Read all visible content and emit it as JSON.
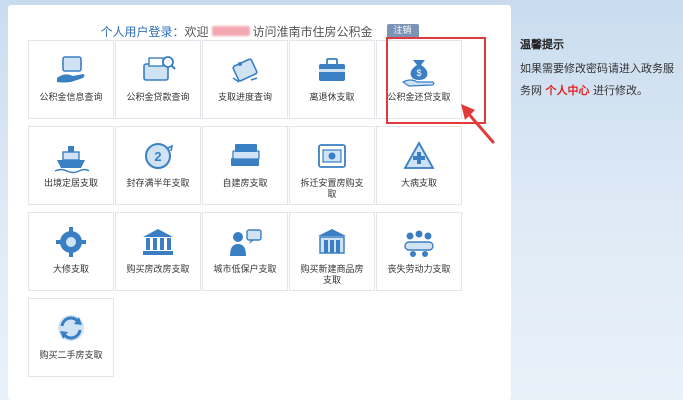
{
  "login": {
    "label": "个人用户登录：",
    "welcome": "欢迎",
    "visit_text": "访问淮南市住房公积金",
    "logout_label": "注销"
  },
  "tiles": [
    {
      "label": "公积金信息查询",
      "icon": "hand-box-icon"
    },
    {
      "label": "公积金贷款查询",
      "icon": "printer-search-icon"
    },
    {
      "label": "支取进度查询",
      "icon": "clock-tag-icon"
    },
    {
      "label": "离退休支取",
      "icon": "briefcase-icon"
    },
    {
      "label": "公积金还贷支取",
      "icon": "money-bag-hand-icon"
    },
    {
      "label": "出境定居支取",
      "icon": "ship-icon"
    },
    {
      "label": "封存满半年支取",
      "icon": "timer-icon"
    },
    {
      "label": "自建房支取",
      "icon": "money-stack-icon"
    },
    {
      "label": "拆迁安置房购支取",
      "icon": "banknote-icon"
    },
    {
      "label": "大病支取",
      "icon": "medical-cross-icon"
    },
    {
      "label": "大修支取",
      "icon": "gear-icon"
    },
    {
      "label": "购买房改房支取",
      "icon": "bank-building-icon"
    },
    {
      "label": "城市低保户支取",
      "icon": "person-chat-icon"
    },
    {
      "label": "购买新建商品房支取",
      "icon": "building-icon"
    },
    {
      "label": "丧失劳动力支取",
      "icon": "meeting-icon"
    },
    {
      "label": "购买二手房支取",
      "icon": "refresh-icon"
    }
  ],
  "hint": {
    "title": "温馨提示",
    "text1": "如果需要修改密码请进入政务服务网",
    "highlight": "个人中心",
    "text2": "进行修改。"
  },
  "colors": {
    "accent": "#2f6fb8",
    "highlight_red": "#e03a3a",
    "icon_blue": "#3a7fc4",
    "icon_light": "#cfe3f5"
  }
}
